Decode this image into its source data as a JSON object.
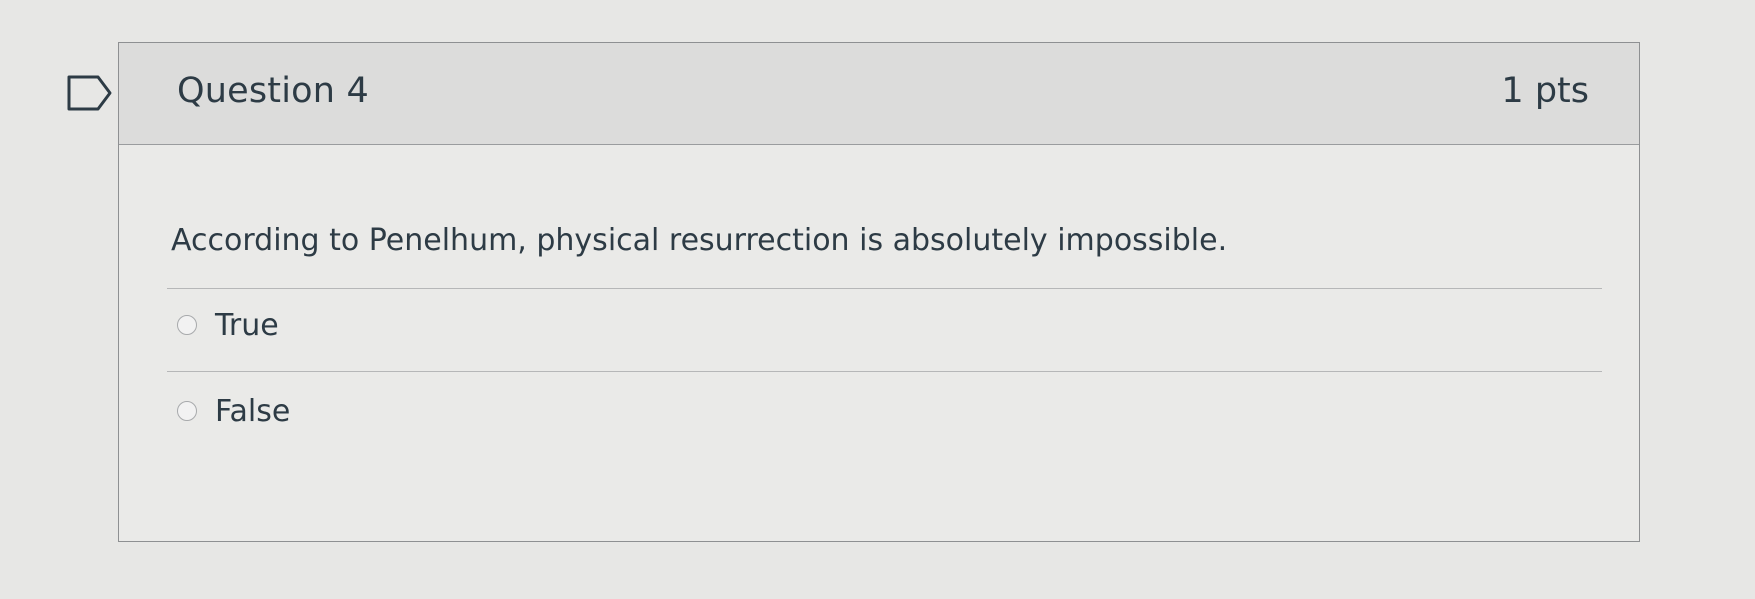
{
  "question": {
    "title": "Question 4",
    "points": "1 pts",
    "text": "According to Penelhum, physical resurrection is absolutely impossible.",
    "answers": [
      {
        "label": "True",
        "selected": false
      },
      {
        "label": "False",
        "selected": false
      }
    ]
  },
  "icons": {
    "flag": "flag-outline-icon",
    "radio": "radio-unselected-icon"
  },
  "colors": {
    "text": "#2d3b45",
    "header_bg": "#dcdcdb",
    "border": "#8e9092"
  }
}
